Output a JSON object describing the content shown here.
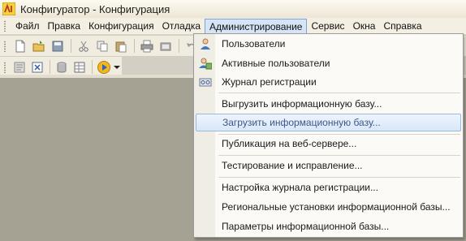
{
  "window": {
    "title": "Конфигуратор - Конфигурация"
  },
  "menubar": {
    "items": [
      {
        "label": "Файл"
      },
      {
        "label": "Правка"
      },
      {
        "label": "Конфигурация"
      },
      {
        "label": "Отладка"
      },
      {
        "label": "Администрирование"
      },
      {
        "label": "Сервис"
      },
      {
        "label": "Окна"
      },
      {
        "label": "Справка"
      }
    ],
    "active_index": 4
  },
  "admin_menu": {
    "items": [
      {
        "label": "Пользователи",
        "icon": "user-icon"
      },
      {
        "label": "Активные пользователи",
        "icon": "active-users-icon"
      },
      {
        "label": "Журнал регистрации",
        "icon": "event-log-icon"
      },
      {
        "label": "Выгрузить информационную базу..."
      },
      {
        "label": "Загрузить информационную базу...",
        "highlighted": true
      },
      {
        "label": "Публикация на веб-сервере..."
      },
      {
        "label": "Тестирование и исправление..."
      },
      {
        "label": "Настройка журнала регистрации..."
      },
      {
        "label": "Региональные установки информационной базы..."
      },
      {
        "label": "Параметры информационной базы..."
      }
    ]
  },
  "toolbar_icons": [
    "new-document-icon",
    "open-folder-icon",
    "save-icon",
    "cut-icon",
    "copy-icon",
    "paste-icon",
    "print-icon",
    "find-icon",
    "undo-icon"
  ],
  "toolbar2_icons": [
    "config-window-icon",
    "compare-icon",
    "database-icon",
    "table-icon",
    "run-debug-icon"
  ],
  "colors": {
    "work_area": "#a5a193",
    "menu_highlight": "#dae7f8",
    "highlight_text": "#3c5887"
  }
}
